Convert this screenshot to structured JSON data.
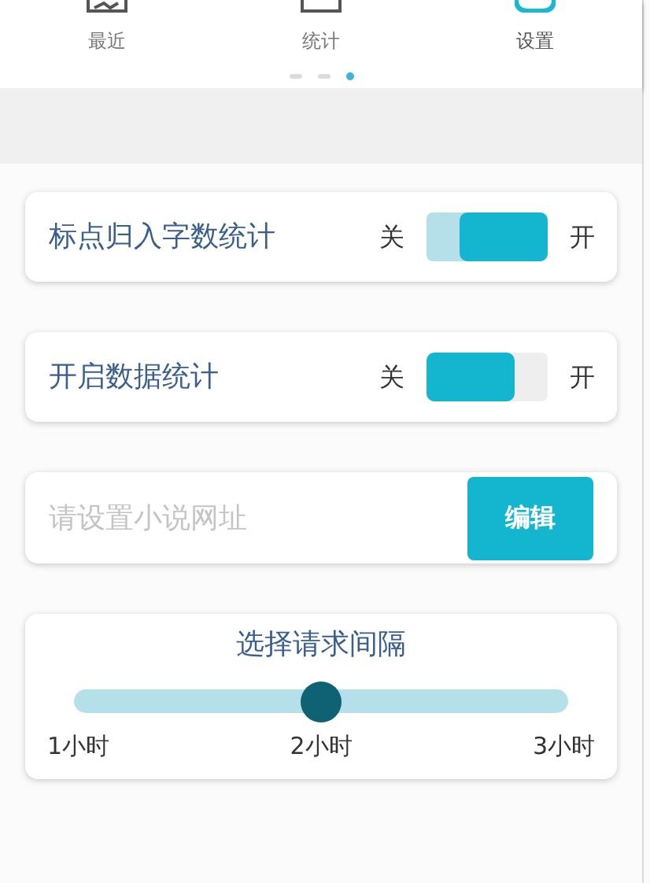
{
  "tabs": [
    {
      "label": "最近",
      "kind": "recent",
      "selected": false
    },
    {
      "label": "统计",
      "kind": "stats",
      "selected": false
    },
    {
      "label": "设置",
      "kind": "settings",
      "selected": true
    }
  ],
  "pager": [
    {
      "selected": false
    },
    {
      "selected": false
    },
    {
      "selected": true
    }
  ],
  "settings": [
    {
      "kind": "switch",
      "label": "标点归入字数统计",
      "off_label": "关",
      "on_label": "开",
      "on": true
    },
    {
      "kind": "switch",
      "label": "开启数据统计",
      "off_label": "关",
      "on_label": "开",
      "on": false
    },
    {
      "kind": "url",
      "placeholder": "请设置小说网址",
      "button": "编辑"
    },
    {
      "kind": "slider",
      "title": "选择请求间隔",
      "level": 0.5,
      "ticks": [
        "1小时",
        "2小时",
        "3小时"
      ]
    }
  ]
}
